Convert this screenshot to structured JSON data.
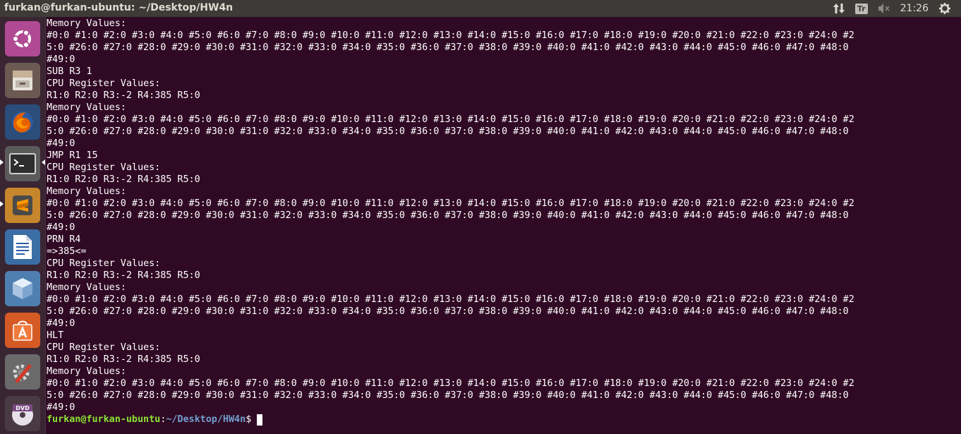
{
  "topbar": {
    "title": "furkan@furkan-ubuntu: ~/Desktop/HW4n",
    "keyboard_indicator": "Tr",
    "clock": "21:26"
  },
  "launcher": [
    {
      "name": "ubuntu-dash",
      "icon": "ubuntu-logo-icon"
    },
    {
      "name": "files",
      "icon": "file-cabinet-icon"
    },
    {
      "name": "firefox",
      "icon": "firefox-icon"
    },
    {
      "name": "terminal",
      "icon": "terminal-icon"
    },
    {
      "name": "sublime-text",
      "icon": "sublime-text-icon"
    },
    {
      "name": "libreoffice-writer",
      "icon": "document-icon"
    },
    {
      "name": "virtualbox",
      "icon": "cube-icon"
    },
    {
      "name": "software-center",
      "icon": "shopping-bag-icon"
    },
    {
      "name": "system-settings",
      "icon": "gear-wrench-icon"
    },
    {
      "name": "dvd",
      "icon": "dvd-disc-icon"
    }
  ],
  "terminal": {
    "lines": [
      "Memory Values:",
      "#0:0 #1:0 #2:0 #3:0 #4:0 #5:0 #6:0 #7:0 #8:0 #9:0 #10:0 #11:0 #12:0 #13:0 #14:0 #15:0 #16:0 #17:0 #18:0 #19:0 #20:0 #21:0 #22:0 #23:0 #24:0 #2",
      "5:0 #26:0 #27:0 #28:0 #29:0 #30:0 #31:0 #32:0 #33:0 #34:0 #35:0 #36:0 #37:0 #38:0 #39:0 #40:0 #41:0 #42:0 #43:0 #44:0 #45:0 #46:0 #47:0 #48:0",
      "#49:0",
      "SUB R3 1",
      "CPU Register Values:",
      "R1:0 R2:0 R3:-2 R4:385 R5:0",
      "Memory Values:",
      "#0:0 #1:0 #2:0 #3:0 #4:0 #5:0 #6:0 #7:0 #8:0 #9:0 #10:0 #11:0 #12:0 #13:0 #14:0 #15:0 #16:0 #17:0 #18:0 #19:0 #20:0 #21:0 #22:0 #23:0 #24:0 #2",
      "5:0 #26:0 #27:0 #28:0 #29:0 #30:0 #31:0 #32:0 #33:0 #34:0 #35:0 #36:0 #37:0 #38:0 #39:0 #40:0 #41:0 #42:0 #43:0 #44:0 #45:0 #46:0 #47:0 #48:0",
      "#49:0",
      "JMP R1 15",
      "CPU Register Values:",
      "R1:0 R2:0 R3:-2 R4:385 R5:0",
      "Memory Values:",
      "#0:0 #1:0 #2:0 #3:0 #4:0 #5:0 #6:0 #7:0 #8:0 #9:0 #10:0 #11:0 #12:0 #13:0 #14:0 #15:0 #16:0 #17:0 #18:0 #19:0 #20:0 #21:0 #22:0 #23:0 #24:0 #2",
      "5:0 #26:0 #27:0 #28:0 #29:0 #30:0 #31:0 #32:0 #33:0 #34:0 #35:0 #36:0 #37:0 #38:0 #39:0 #40:0 #41:0 #42:0 #43:0 #44:0 #45:0 #46:0 #47:0 #48:0",
      "#49:0",
      "PRN R4",
      "=>385<=",
      "CPU Register Values:",
      "R1:0 R2:0 R3:-2 R4:385 R5:0",
      "Memory Values:",
      "#0:0 #1:0 #2:0 #3:0 #4:0 #5:0 #6:0 #7:0 #8:0 #9:0 #10:0 #11:0 #12:0 #13:0 #14:0 #15:0 #16:0 #17:0 #18:0 #19:0 #20:0 #21:0 #22:0 #23:0 #24:0 #2",
      "5:0 #26:0 #27:0 #28:0 #29:0 #30:0 #31:0 #32:0 #33:0 #34:0 #35:0 #36:0 #37:0 #38:0 #39:0 #40:0 #41:0 #42:0 #43:0 #44:0 #45:0 #46:0 #47:0 #48:0",
      "#49:0",
      "HLT",
      "CPU Register Values:",
      "R1:0 R2:0 R3:-2 R4:385 R5:0",
      "Memory Values:",
      "#0:0 #1:0 #2:0 #3:0 #4:0 #5:0 #6:0 #7:0 #8:0 #9:0 #10:0 #11:0 #12:0 #13:0 #14:0 #15:0 #16:0 #17:0 #18:0 #19:0 #20:0 #21:0 #22:0 #23:0 #24:0 #2",
      "5:0 #26:0 #27:0 #28:0 #29:0 #30:0 #31:0 #32:0 #33:0 #34:0 #35:0 #36:0 #37:0 #38:0 #39:0 #40:0 #41:0 #42:0 #43:0 #44:0 #45:0 #46:0 #47:0 #48:0",
      "#49:0"
    ],
    "prompt": {
      "user_host": "furkan@furkan-ubuntu",
      "colon": ":",
      "path": "~/Desktop/HW4n",
      "dollar": "$"
    }
  }
}
